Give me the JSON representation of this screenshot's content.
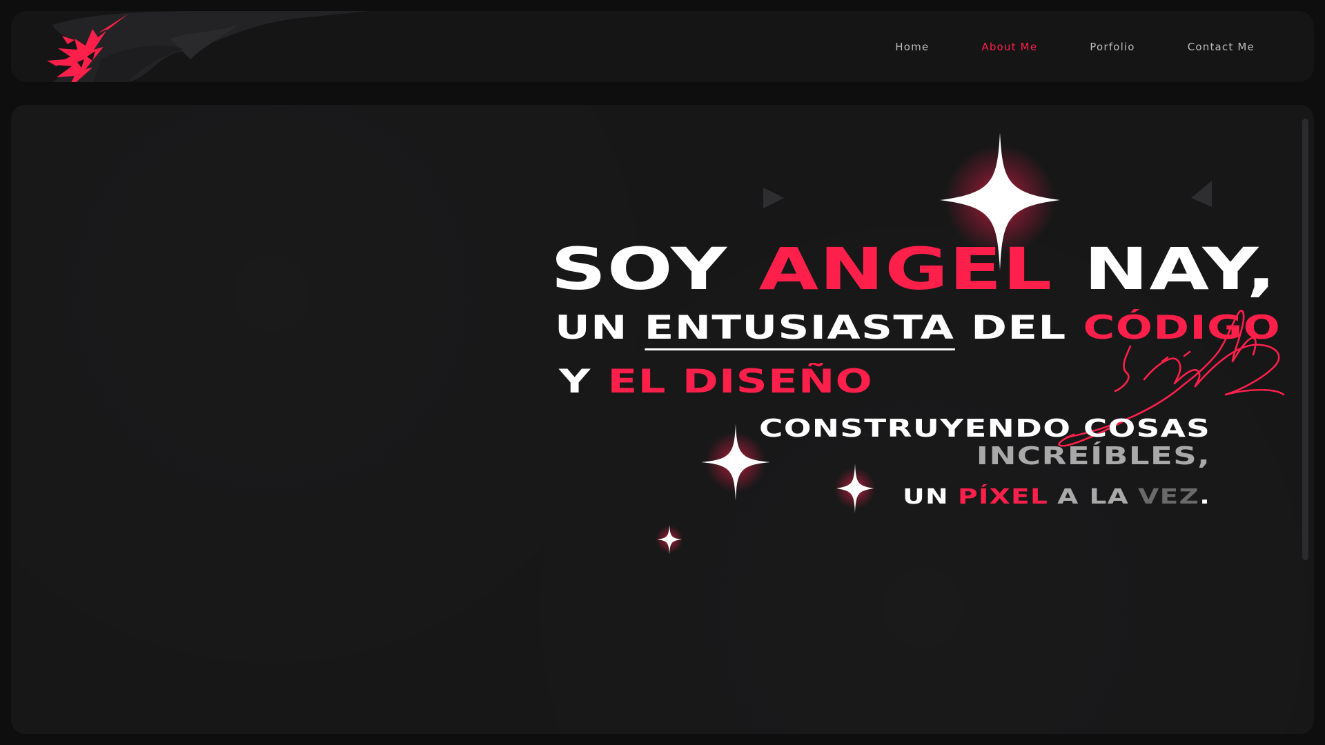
{
  "nav": {
    "items": [
      {
        "label": "Home",
        "active": false
      },
      {
        "label": "About Me",
        "active": true
      },
      {
        "label": "Porfolio",
        "active": false
      },
      {
        "label": "Contact Me",
        "active": false
      }
    ]
  },
  "hero": {
    "line1": {
      "w1": "SOY",
      "r1": "ANGEL",
      "w2": "NAY,"
    },
    "line2": {
      "w1": "UN",
      "u1": "ENTUSIASTA",
      "w2": "DEL",
      "r1": "CÓDIGO"
    },
    "line3": {
      "w1": "Y",
      "r1": "EL DISEÑO"
    },
    "line4": {
      "w1": "CONSTRUYENDO COSAS"
    },
    "line5": {
      "g1": "INCREÍBLES,"
    },
    "line6": {
      "w1": "UN",
      "r1": "PÍXEL",
      "g1": "A LA",
      "dg1": "VEZ",
      "w2": "."
    }
  },
  "colors": {
    "accent": "#ff1f4b",
    "background": "#0e0e0f",
    "panel": "#171718",
    "text": "#ffffff",
    "muted": "#a9a9a9"
  },
  "icons": [
    "logo-mark",
    "sparkle-icon",
    "signature-mark",
    "arrow-ornament"
  ]
}
